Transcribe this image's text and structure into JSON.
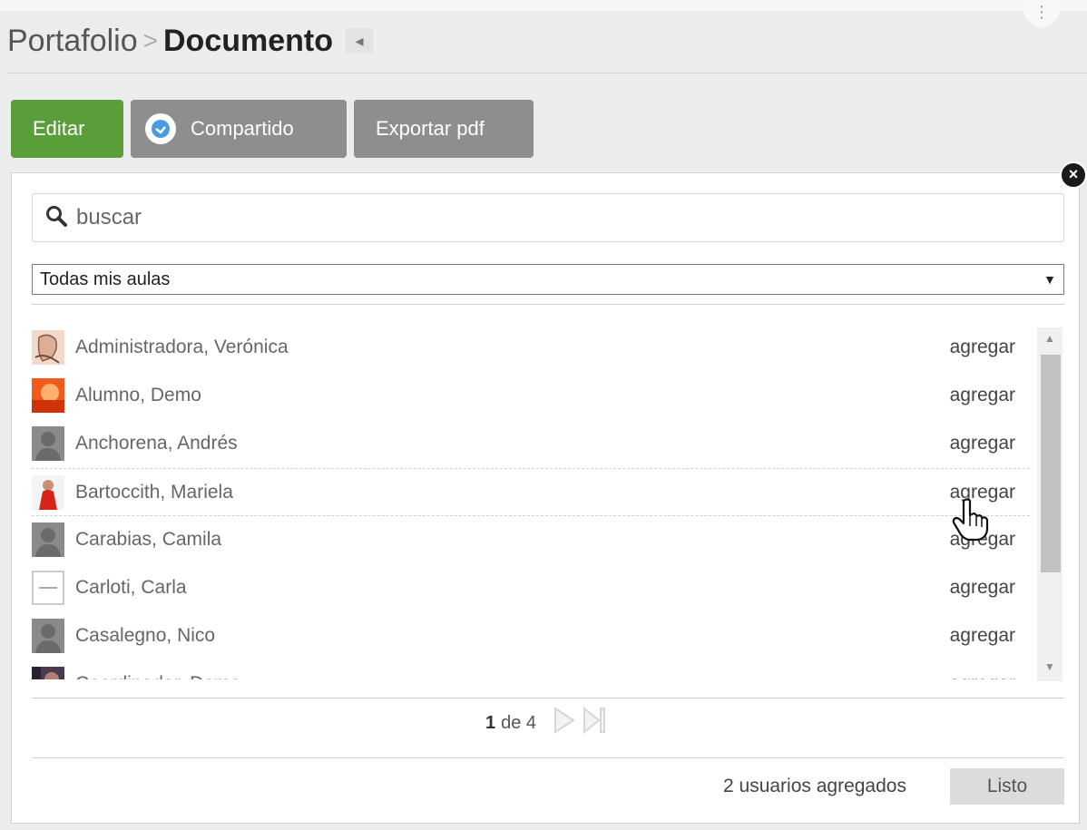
{
  "header": {
    "breadcrumb_root": "Portafolio",
    "breadcrumb_separator": ">",
    "breadcrumb_current": "Documento"
  },
  "toolbar": {
    "edit_label": "Editar",
    "share_label": "Compartido",
    "export_label": "Exportar pdf"
  },
  "search": {
    "placeholder": "buscar"
  },
  "filter": {
    "selected": "Todas mis aulas"
  },
  "users": [
    {
      "name": "Administradora, Verónica",
      "action": "agregar",
      "avatar": "photo-sketch"
    },
    {
      "name": "Alumno, Demo",
      "action": "agregar",
      "avatar": "photo-orange"
    },
    {
      "name": "Anchorena, Andrés",
      "action": "agregar",
      "avatar": "default-silhouette"
    },
    {
      "name": "Bartoccith, Mariela",
      "action": "agregar",
      "avatar": "photo-red"
    },
    {
      "name": "Carabias, Camila",
      "action": "agregar",
      "avatar": "default-silhouette"
    },
    {
      "name": "Carloti, Carla",
      "action": "agregar",
      "avatar": "photo-blank"
    },
    {
      "name": "Casalegno, Nico",
      "action": "agregar",
      "avatar": "default-silhouette"
    },
    {
      "name": "Coordinador, Demo",
      "action": "agregar",
      "avatar": "photo-dark"
    }
  ],
  "pagination": {
    "current": "1",
    "of_text": "de 4"
  },
  "footer": {
    "added_count_text": "2 usuarios agregados",
    "done_label": "Listo"
  },
  "colors": {
    "edit_button": "#5a9e3a",
    "gray_button": "#8e8e8e",
    "done_button": "#dcdcdc"
  }
}
